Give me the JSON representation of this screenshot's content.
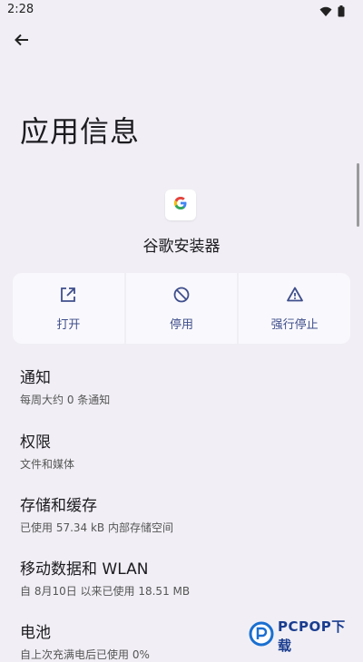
{
  "theme": {
    "bg": "#f1eff5",
    "card": "#f9f8fc",
    "accent": "#3f4f8c"
  },
  "status_bar": {
    "time": "2:28",
    "icons": [
      "wifi-icon",
      "battery-icon"
    ]
  },
  "header": {
    "back_icon": "arrow-back-icon",
    "title": "应用信息"
  },
  "app": {
    "icon": "google-g-icon",
    "name": "谷歌安装器"
  },
  "actions": [
    {
      "label": "打开",
      "icon": "open-external-icon"
    },
    {
      "label": "停用",
      "icon": "disable-icon"
    },
    {
      "label": "强行停止",
      "icon": "warning-icon"
    }
  ],
  "settings": [
    {
      "title": "通知",
      "subtitle": "每周大约 0 条通知"
    },
    {
      "title": "权限",
      "subtitle": "文件和媒体"
    },
    {
      "title": "存储和缓存",
      "subtitle": "已使用 57.34 kB 内部存储空间"
    },
    {
      "title": "移动数据和 WLAN",
      "subtitle": "自 8月10日 以来已使用 18.51 MB"
    },
    {
      "title": "电池",
      "subtitle": "自上次充满电后已使用 0%"
    }
  ],
  "watermark": {
    "text": "PCPOP下载"
  }
}
